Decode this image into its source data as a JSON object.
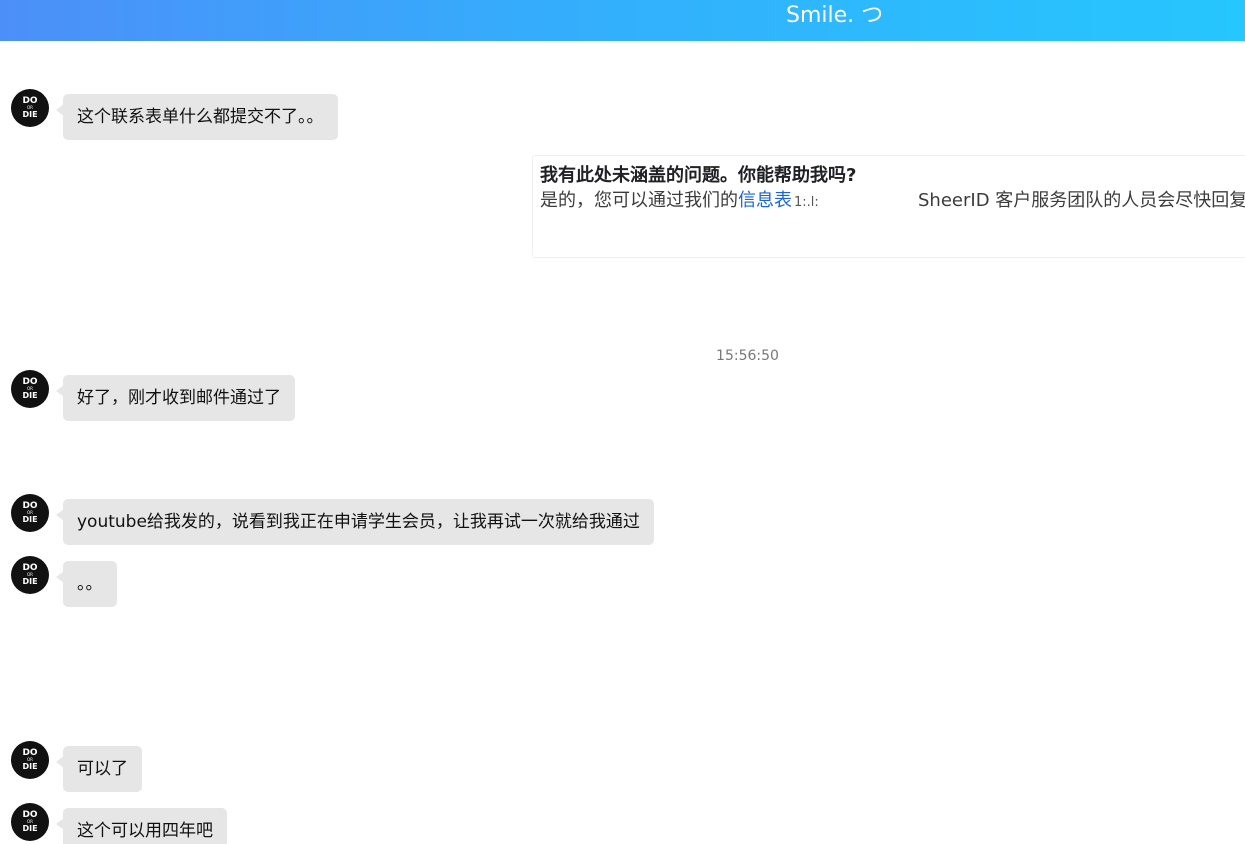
{
  "header": {
    "title": "Smile. つ"
  },
  "avatar": {
    "line1": "DO",
    "line2": "OR",
    "line3": "DIE"
  },
  "faq_card": {
    "question": "我有此处未涵盖的问题。你能帮助我吗?",
    "answer_prefix": "是的，您可以通过我们的",
    "answer_link": "信息表",
    "answer_tail": "1:.l:",
    "answer_suffix": "SheerID 客户服务团队的人员会尽快回复"
  },
  "timestamp": "15:56:50",
  "messages": [
    {
      "text": "这个联系表单什么都提交不了。。"
    },
    {
      "text": "好了，刚才收到邮件通过了"
    },
    {
      "text": "youtube给我发的，说看到我正在申请学生会员，让我再试一次就给我通过"
    },
    {
      "text": "。。"
    },
    {
      "text": "可以了"
    },
    {
      "text": "这个可以用四年吧"
    }
  ]
}
